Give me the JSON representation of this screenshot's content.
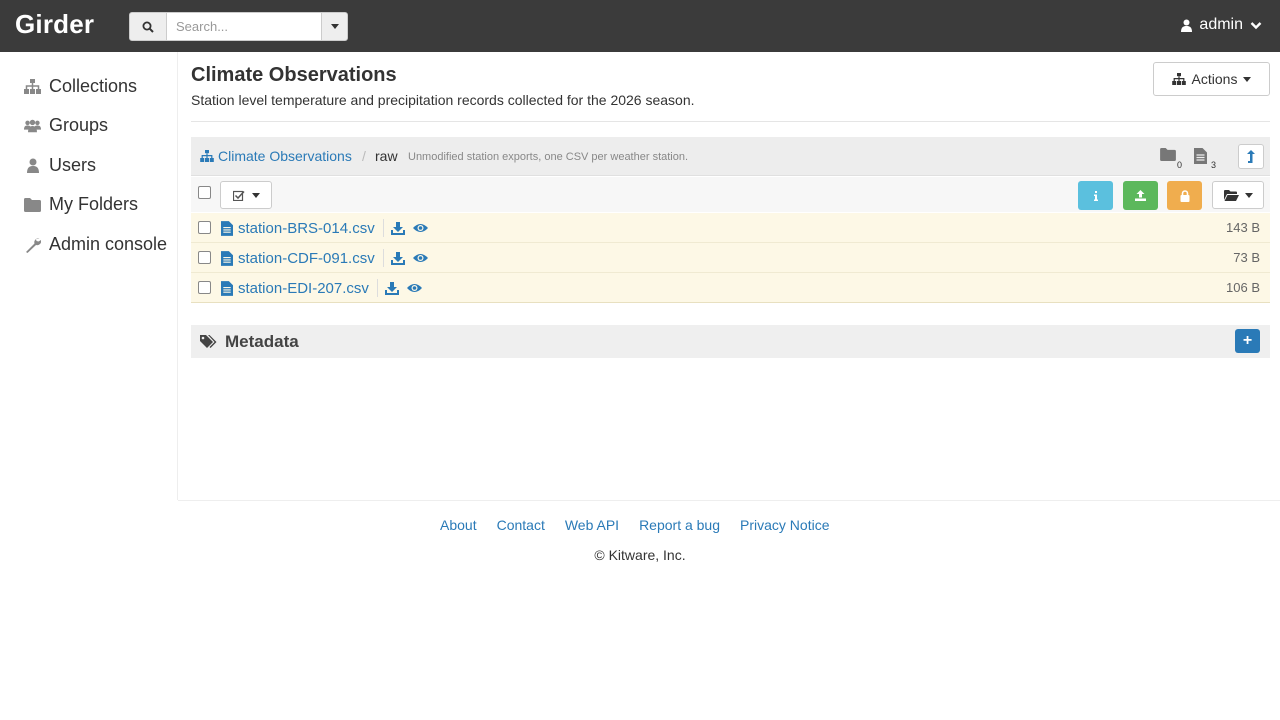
{
  "header": {
    "brand": "Girder",
    "search_placeholder": "Search...",
    "user": "admin"
  },
  "sidebar": {
    "items": [
      {
        "label": "Collections",
        "icon": "sitemap-icon"
      },
      {
        "label": "Groups",
        "icon": "users-icon"
      },
      {
        "label": "Users",
        "icon": "user-icon"
      },
      {
        "label": "My Folders",
        "icon": "folder-icon"
      },
      {
        "label": "Admin console",
        "icon": "wrench-icon"
      }
    ]
  },
  "main": {
    "title": "Climate Observations",
    "description": "Station level temperature and precipitation records collected for the 2026 season.",
    "actions_label": "Actions",
    "breadcrumb": {
      "root": "Climate Observations",
      "separator": "/",
      "current": "raw",
      "current_description": "Unmodified station exports, one CSV per weather station.",
      "folder_count": "0",
      "item_count": "3"
    },
    "files": [
      {
        "name": "station-BRS-014.csv",
        "size": "143 B"
      },
      {
        "name": "station-CDF-091.csv",
        "size": "73 B"
      },
      {
        "name": "station-EDI-207.csv",
        "size": "106 B"
      }
    ],
    "metadata_title": "Metadata",
    "metadata_add": "+"
  },
  "footer": {
    "links": [
      "About",
      "Contact",
      "Web API",
      "Report a bug",
      "Privacy Notice"
    ],
    "copyright": "© Kitware, Inc."
  },
  "colors": {
    "header_bg": "#3b3b3b",
    "link": "#2a7ab7",
    "info": "#5bc0de",
    "success": "#5cb85c",
    "warning": "#f0ad4e",
    "row_bg": "#fdf8e6"
  }
}
